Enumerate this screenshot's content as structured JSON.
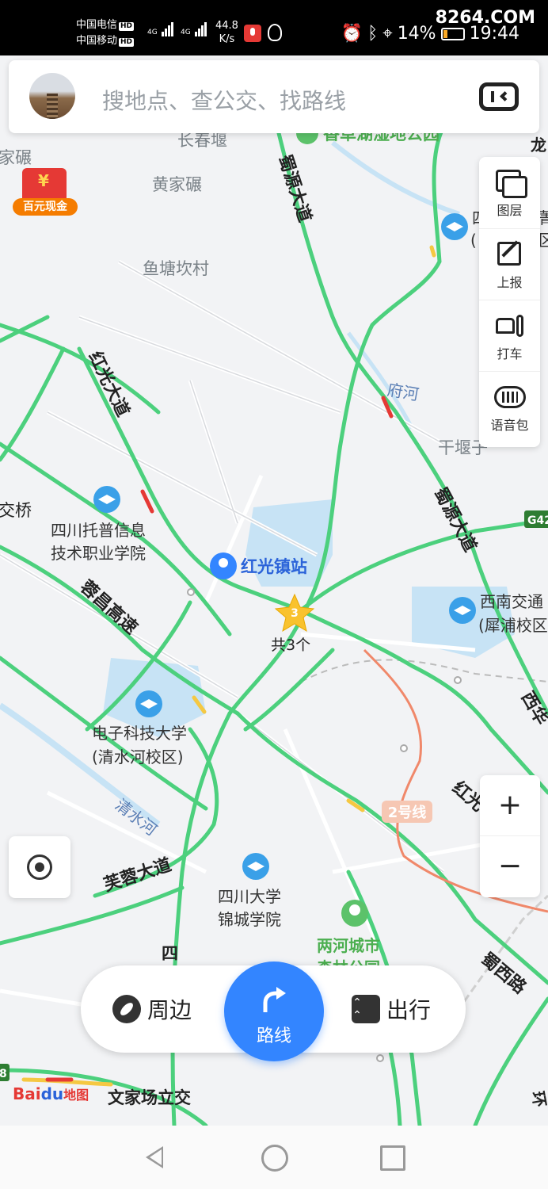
{
  "status_bar": {
    "carrier1": "中国电信",
    "carrier2": "中国移动",
    "hd": "HD",
    "net1": "4G",
    "net2": "4G",
    "speed_value": "44.8",
    "speed_unit": "K/s",
    "battery": "14%",
    "time": "19:44",
    "watermark": "8264.COM"
  },
  "search": {
    "placeholder": "搜地点、查公交、找路线"
  },
  "promo": {
    "label": "百元现金"
  },
  "tools": {
    "layers": "图层",
    "report": "上报",
    "taxi": "打车",
    "voice_pack": "语音包"
  },
  "map_labels": {
    "place1": "家碾",
    "place2": "长春堰",
    "place3": "香草湖湿地公园",
    "place4": "黄家碾",
    "place5": "鱼塘坎村",
    "road_shuyuan1": "蜀源大道",
    "road_shuyuan2": "蜀源大道",
    "road_hongguang": "红光大道",
    "river_fu": "府河",
    "place_ganyan": "干堰子",
    "place_jiao": "交桥",
    "school1_l1": "四川托普信息",
    "school1_l2": "技术职业学院",
    "station": "红光镇站",
    "cluster_count": "3",
    "cluster_label": "共3个",
    "road_rongchang": "蓉昌高速",
    "school2_l1": "西南交通",
    "school2_l2": "(犀浦校区",
    "school3_l1": "电子科技大学",
    "school3_l2": "(清水河校区)",
    "river_qingshui": "清水河",
    "road_furong": "芙蓉大道",
    "school4_l1": "四川大学",
    "school4_l2": "锦城学院",
    "park_l1": "两河城市",
    "park_l2": "森林公园",
    "metro_line": "2号线",
    "road_hong2": "红光",
    "road_shuxi": "蜀西路",
    "road_xi": "西华",
    "place_wenjia": "文家场立交",
    "road_si": "四",
    "school_partial": "四",
    "school_partial2": "(",
    "right_edge1": "龙",
    "right_edge2": "菁",
    "right_edge3": "区",
    "highway_shield": "G42",
    "left_shield": "8",
    "right_bottom": "环"
  },
  "zoom": {
    "in": "+",
    "out": "−"
  },
  "bottom_bar": {
    "nearby": "周边",
    "route": "路线",
    "travel": "出行"
  },
  "logo": {
    "bai": "Bai",
    "du": "du",
    "map": "地图"
  },
  "colors": {
    "road_green": "#4cd07d",
    "road_yellow": "#f5c842",
    "road_red": "#e53935",
    "metro": "#f0886a",
    "water": "#c7e3f5",
    "accent": "#3385ff",
    "poi_blue": "#3aa0e8"
  }
}
